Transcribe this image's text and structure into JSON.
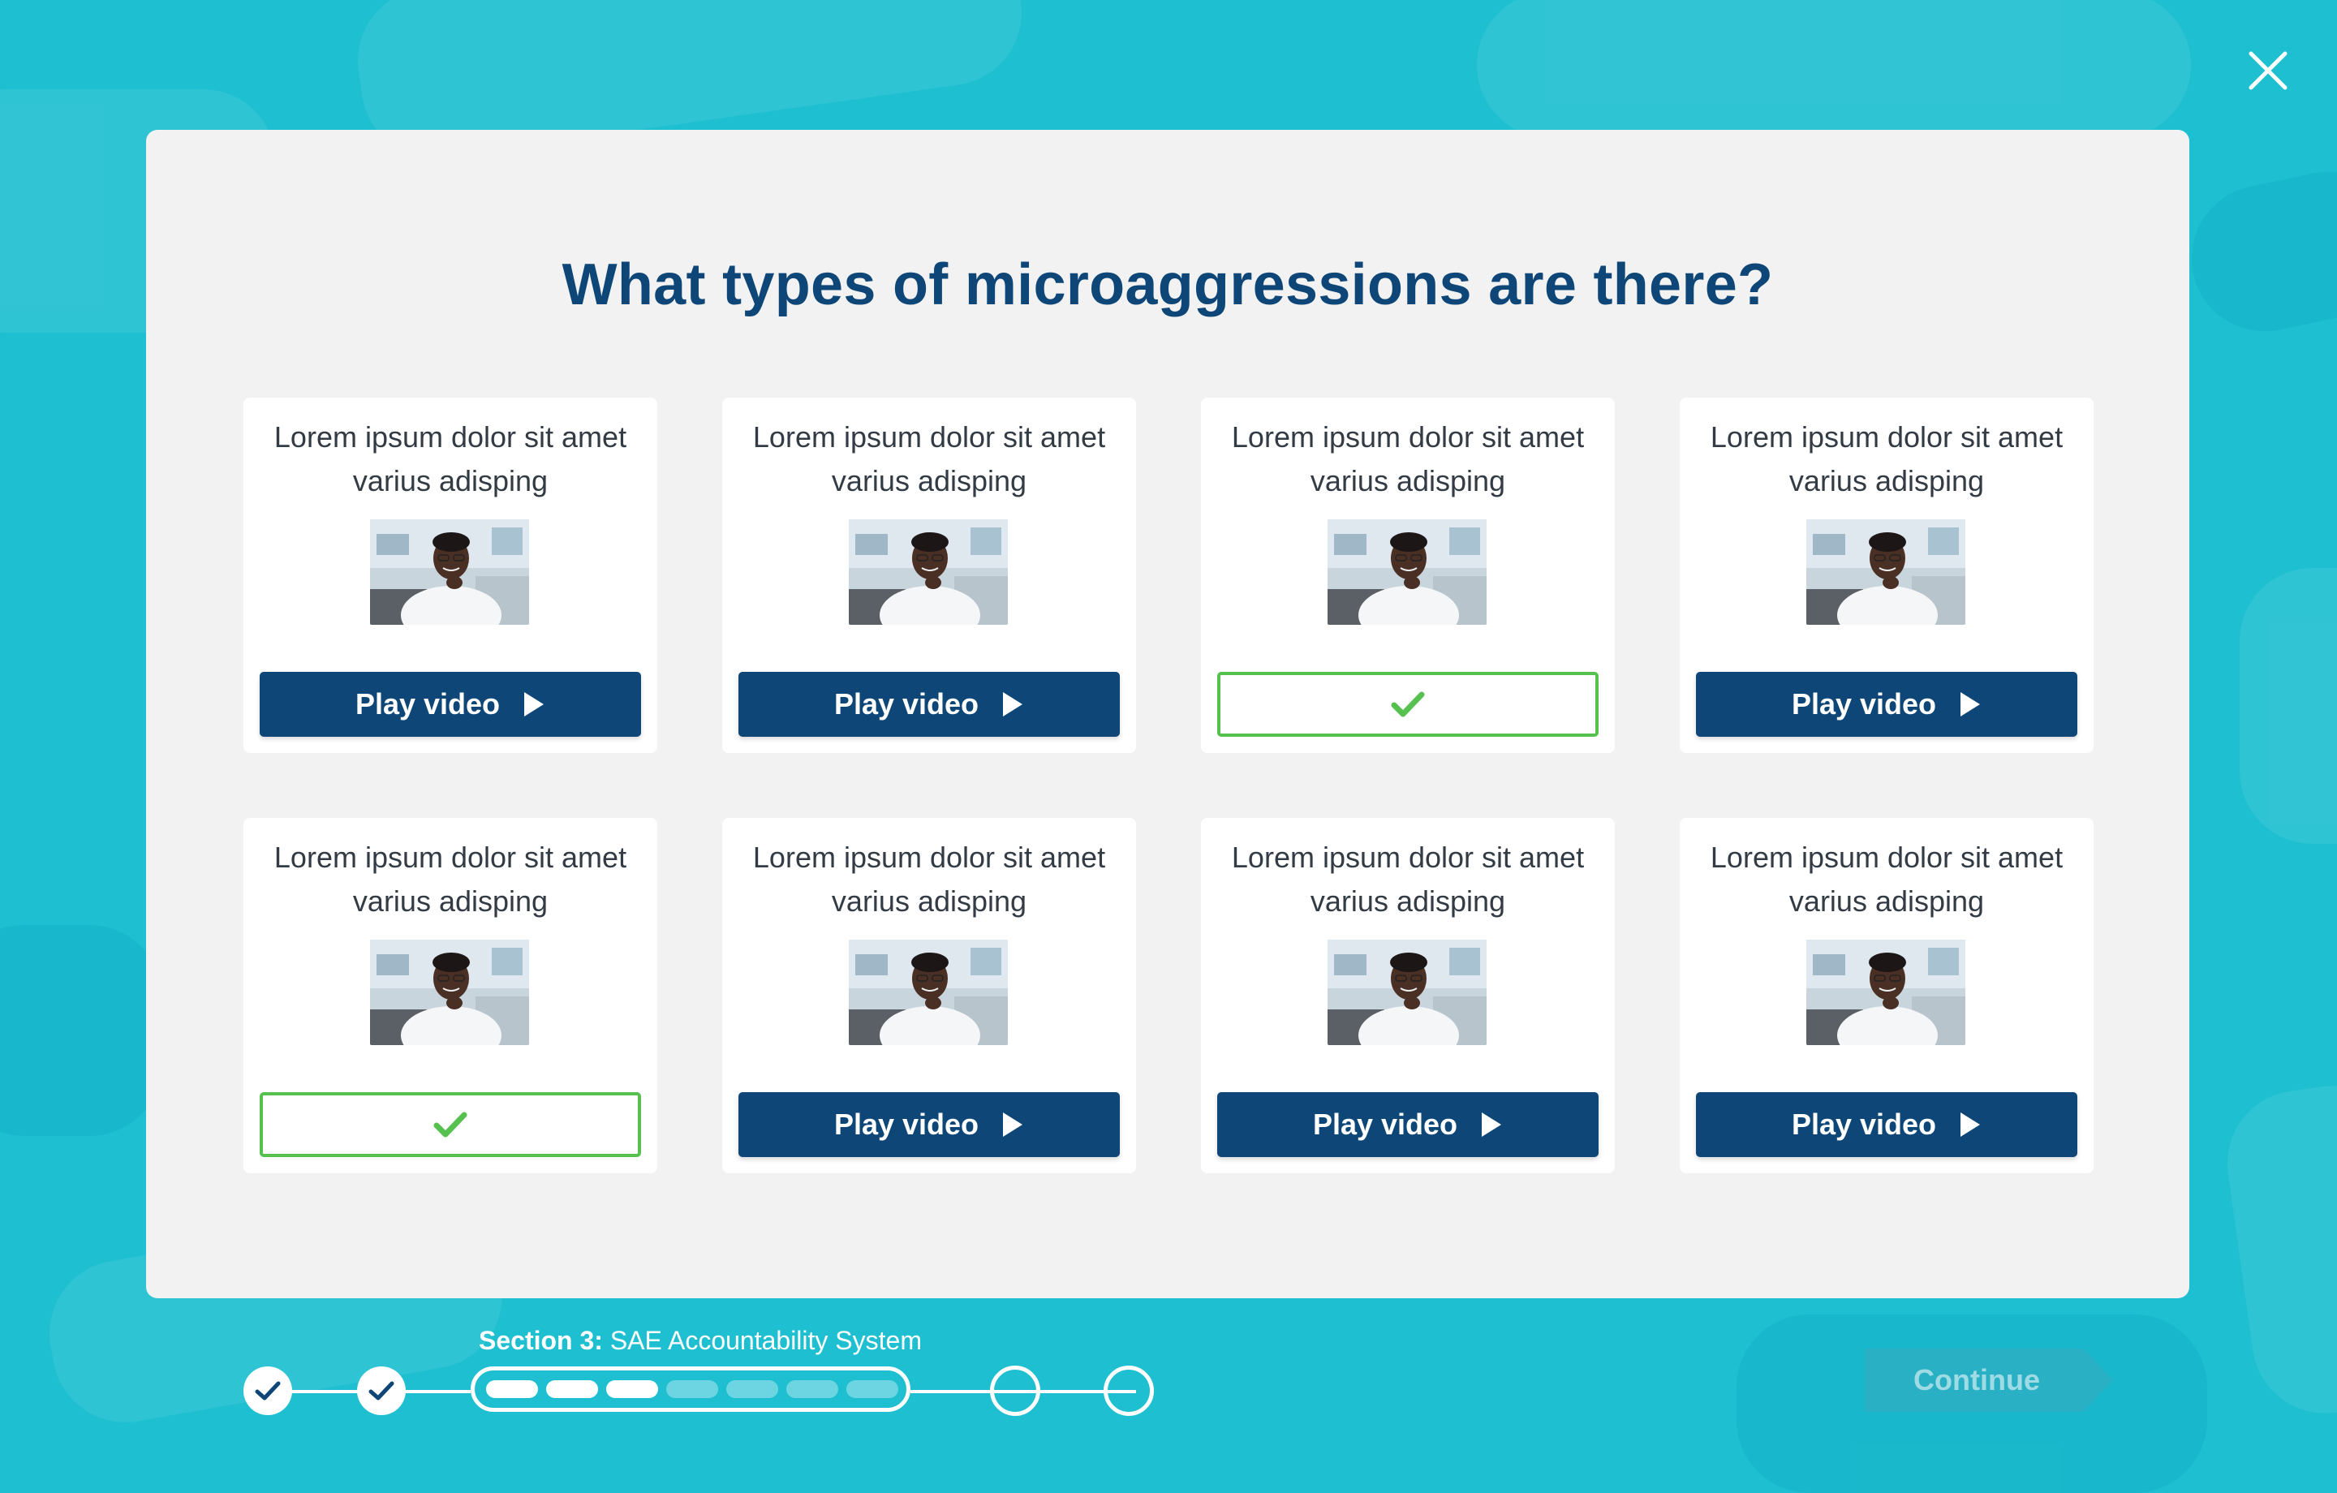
{
  "modal": {
    "title": "What types of microaggressions are there?"
  },
  "cards": [
    {
      "text": "Lorem ipsum dolor sit amet varius adisping",
      "status": "play",
      "button_label": "Play video"
    },
    {
      "text": "Lorem ipsum dolor sit amet varius adisping",
      "status": "play",
      "button_label": "Play video"
    },
    {
      "text": "Lorem ipsum dolor sit amet varius adisping",
      "status": "watched",
      "button_label": ""
    },
    {
      "text": "Lorem ipsum dolor sit amet varius adisping",
      "status": "play",
      "button_label": "Play video"
    },
    {
      "text": "Lorem ipsum dolor sit amet varius adisping",
      "status": "watched",
      "button_label": ""
    },
    {
      "text": "Lorem ipsum dolor sit amet varius adisping",
      "status": "play",
      "button_label": "Play video"
    },
    {
      "text": "Lorem ipsum dolor sit amet varius adisping",
      "status": "play",
      "button_label": "Play video"
    },
    {
      "text": "Lorem ipsum dolor sit amet varius adisping",
      "status": "play",
      "button_label": "Play video"
    }
  ],
  "progress": {
    "section_prefix": "Section 3:",
    "section_name": "SAE Accountability System",
    "completed_sections": 2,
    "upcoming_sections": 2,
    "current_section_steps_total": 7,
    "current_section_steps_done": 3
  },
  "footer": {
    "continue_label": "Continue"
  },
  "icons": {
    "close": "close-icon",
    "play": "play-icon",
    "check": "check-icon"
  },
  "colors": {
    "background": "#1ebfd1",
    "primary": "#0e4777",
    "success": "#56c14e",
    "modal_bg": "#f2f2f2",
    "continue_disabled": "#29b0c4"
  }
}
